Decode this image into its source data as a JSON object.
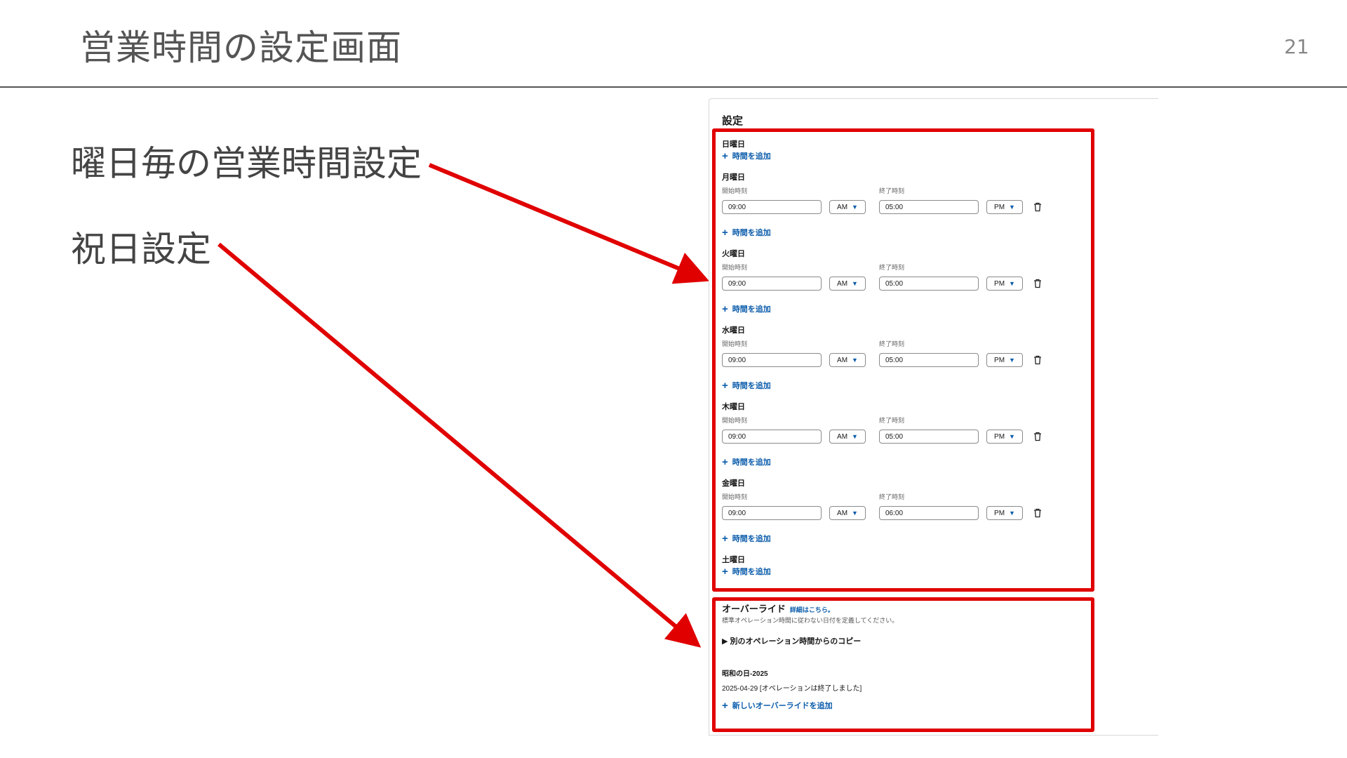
{
  "slide": {
    "title": "営業時間の設定画面",
    "page_number": "21",
    "callout_weekday": "曜日毎の営業時間設定",
    "callout_holiday": "祝日設定",
    "accent_color": "#e00000"
  },
  "panel": {
    "heading": "設定",
    "start_label": "開始時刻",
    "end_label": "終了時刻",
    "add_time_label": "時間を追加",
    "days": [
      {
        "name": "日曜日"
      },
      {
        "name": "月曜日",
        "start": "09:00",
        "start_period": "AM",
        "end": "05:00",
        "end_period": "PM"
      },
      {
        "name": "火曜日",
        "start": "09:00",
        "start_period": "AM",
        "end": "05:00",
        "end_period": "PM"
      },
      {
        "name": "水曜日",
        "start": "09:00",
        "start_period": "AM",
        "end": "05:00",
        "end_period": "PM"
      },
      {
        "name": "木曜日",
        "start": "09:00",
        "start_period": "AM",
        "end": "05:00",
        "end_period": "PM"
      },
      {
        "name": "金曜日",
        "start": "09:00",
        "start_period": "AM",
        "end": "06:00",
        "end_period": "PM"
      },
      {
        "name": "土曜日"
      }
    ],
    "icons": {
      "add": "plus-icon",
      "delete": "trash-icon",
      "dropdown": "caret-down-icon"
    }
  },
  "override": {
    "title": "オーバーライド",
    "learn_more": "詳細はこちら。",
    "description": "標準オペレーション時間に従わない日付を定義してください。",
    "copy_from": "▶ 別のオペレーション時間からのコピー",
    "holiday_name": "昭和の日-2025",
    "holiday_date_status": "2025-04-29 [オペレーションは終了しました]",
    "add_new": "新しいオーバーライドを追加",
    "link_color": "#0b5cab"
  }
}
